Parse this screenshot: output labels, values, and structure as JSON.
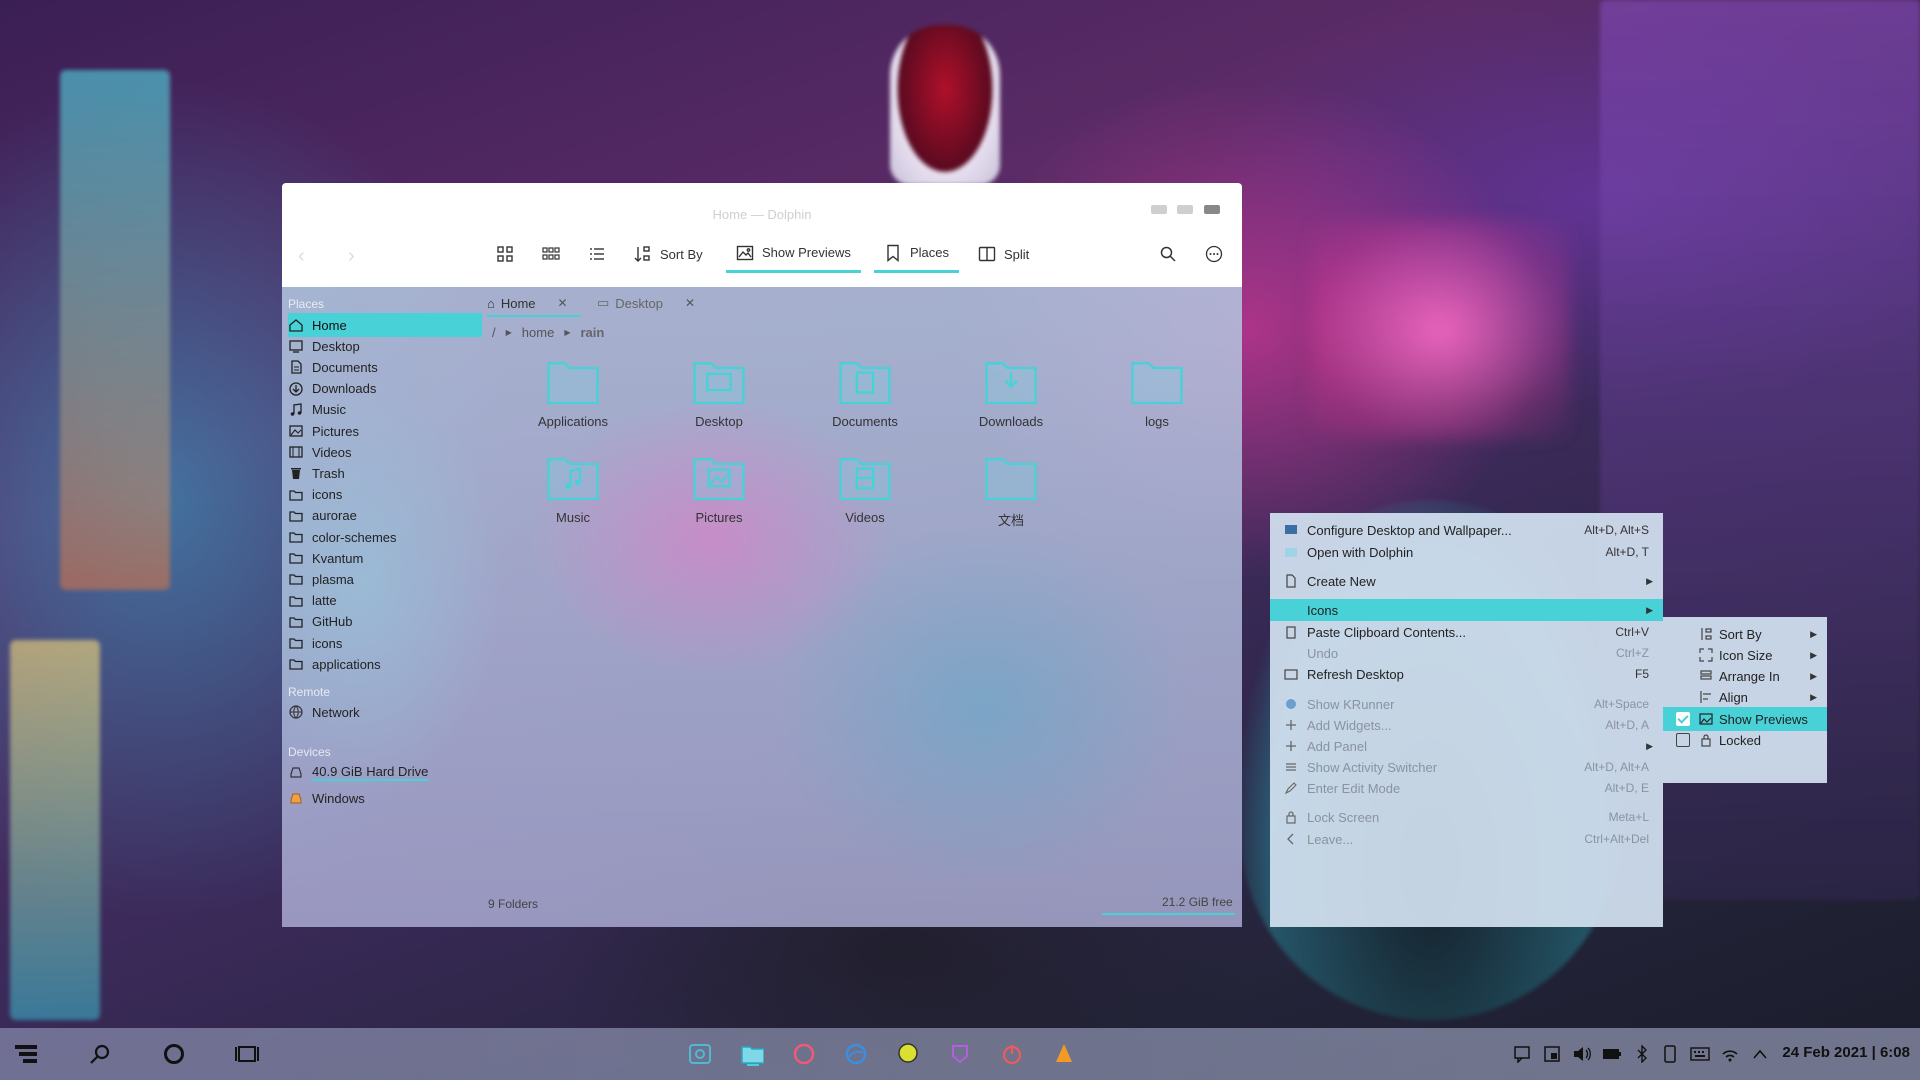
{
  "window": {
    "title": "Home — Dolphin",
    "toolbar": {
      "sort_by": "Sort By",
      "show_previews": "Show Previews",
      "places": "Places",
      "split": "Split"
    },
    "tabs": [
      {
        "label": "Home",
        "active": true
      },
      {
        "label": "Desktop",
        "active": false
      }
    ],
    "breadcrumb": [
      "/",
      "home",
      "rain"
    ],
    "places_header": "Places",
    "places": [
      {
        "label": "Home",
        "icon": "home-icon",
        "selected": true
      },
      {
        "label": "Desktop",
        "icon": "desktop-icon"
      },
      {
        "label": "Documents",
        "icon": "documents-icon"
      },
      {
        "label": "Downloads",
        "icon": "downloads-icon"
      },
      {
        "label": "Music",
        "icon": "music-icon"
      },
      {
        "label": "Pictures",
        "icon": "pictures-icon"
      },
      {
        "label": "Videos",
        "icon": "videos-icon"
      },
      {
        "label": "Trash",
        "icon": "trash-icon"
      },
      {
        "label": "icons",
        "icon": "folder-icon"
      },
      {
        "label": "aurorae",
        "icon": "folder-icon"
      },
      {
        "label": "color-schemes",
        "icon": "folder-icon"
      },
      {
        "label": "Kvantum",
        "icon": "folder-icon"
      },
      {
        "label": "plasma",
        "icon": "folder-icon"
      },
      {
        "label": "latte",
        "icon": "folder-icon"
      },
      {
        "label": "GitHub",
        "icon": "folder-icon"
      },
      {
        "label": "icons",
        "icon": "folder-icon"
      },
      {
        "label": "applications",
        "icon": "folder-icon"
      }
    ],
    "remote_header": "Remote",
    "remote": [
      {
        "label": "Network",
        "icon": "network-icon"
      }
    ],
    "devices_header": "Devices",
    "devices": [
      {
        "label": "40.9 GiB Hard Drive",
        "icon": "drive-icon"
      },
      {
        "label": "Windows",
        "icon": "windows-drive-icon"
      }
    ],
    "files": [
      {
        "label": "Applications",
        "icon": "folder-icon"
      },
      {
        "label": "Desktop",
        "icon": "folder-desktop-icon"
      },
      {
        "label": "Documents",
        "icon": "folder-documents-icon"
      },
      {
        "label": "Downloads",
        "icon": "folder-downloads-icon"
      },
      {
        "label": "logs",
        "icon": "folder-icon"
      },
      {
        "label": "Music",
        "icon": "folder-music-icon"
      },
      {
        "label": "Pictures",
        "icon": "folder-pictures-icon"
      },
      {
        "label": "Videos",
        "icon": "folder-videos-icon"
      },
      {
        "label": "文档",
        "icon": "folder-icon"
      }
    ],
    "status_left": "9 Folders",
    "status_right": "21.2 GiB free"
  },
  "context_menu": {
    "items": [
      {
        "label": "Configure Desktop and Wallpaper...",
        "shortcut": "Alt+D, Alt+S",
        "icon": "configure-icon"
      },
      {
        "label": "Open with Dolphin",
        "shortcut": "Alt+D, T",
        "icon": "dolphin-icon"
      },
      {
        "label": "Create New",
        "shortcut": "",
        "icon": "create-new-icon",
        "submenu": true
      },
      {
        "label": "Icons",
        "shortcut": "",
        "icon": "",
        "submenu": true,
        "highlighted": true
      },
      {
        "label": "Paste Clipboard Contents...",
        "shortcut": "Ctrl+V",
        "icon": "paste-icon"
      },
      {
        "label": "Undo",
        "shortcut": "Ctrl+Z",
        "icon": "",
        "disabled": true
      },
      {
        "label": "Refresh Desktop",
        "shortcut": "F5",
        "icon": "refresh-icon"
      },
      {
        "label": "Show KRunner",
        "shortcut": "Alt+Space",
        "icon": "krunner-icon",
        "dim": true
      },
      {
        "label": "Add Widgets...",
        "shortcut": "Alt+D, A",
        "icon": "plus-icon",
        "dim": true
      },
      {
        "label": "Add Panel",
        "shortcut": "",
        "icon": "plus-icon",
        "submenu": true,
        "dim": true
      },
      {
        "label": "Show Activity Switcher",
        "shortcut": "Alt+D, Alt+A",
        "icon": "activities-icon",
        "dim": true
      },
      {
        "label": "Enter Edit Mode",
        "shortcut": "Alt+D, E",
        "icon": "edit-icon",
        "dim": true
      },
      {
        "label": "Lock Screen",
        "shortcut": "Meta+L",
        "icon": "lock-icon",
        "dim": true
      },
      {
        "label": "Leave...",
        "shortcut": "Ctrl+Alt+Del",
        "icon": "leave-icon",
        "dim": true
      }
    ]
  },
  "icons_submenu": {
    "items": [
      {
        "label": "Sort By",
        "submenu": true,
        "icon": "sort-icon"
      },
      {
        "label": "Icon Size",
        "submenu": true,
        "icon": "icon-size-icon"
      },
      {
        "label": "Arrange In",
        "submenu": true,
        "icon": "arrange-icon"
      },
      {
        "label": "Align",
        "submenu": true,
        "icon": "align-icon"
      },
      {
        "label": "Show Previews",
        "checked": true,
        "highlighted": true,
        "icon": "image-icon"
      },
      {
        "label": "Locked",
        "checked": false,
        "icon": "lock-icon"
      }
    ]
  },
  "taskbar": {
    "clock": "24 Feb 2021 | 6:08"
  },
  "colors": {
    "accent": "#48d1d6"
  }
}
